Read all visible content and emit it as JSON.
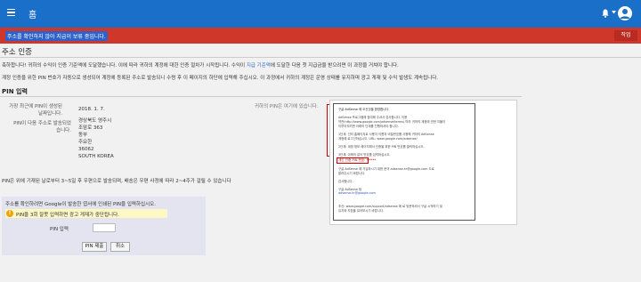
{
  "header": {
    "app_title": "홈",
    "icons": [
      "menu-icon",
      "bell-icon",
      "chevron-down-icon",
      "account-avatar"
    ],
    "brand_color": "#1a6fc9"
  },
  "alert": {
    "text": "주소를 확인하지 않아 지급이 보류 중입니다.",
    "action_label": "작업",
    "color": "#d0372b"
  },
  "page": {
    "title": "주소 인증",
    "para1_a": "축하합니다! 귀하의 수익이 인증 기준액에 도달했습니다. 이에 따라 귀하의 계정에 대한 인증 절차가 시작됩니다. 수익이 ",
    "para1_link": "지급 기준액",
    "para1_b": "에 도달한 다음 첫 지급금을 받으려면 이 과정을 거쳐야 합니다.",
    "para2": "계정 인증을 위한 PIN 번호가 자동으로 생성되어 계정에 등록된 주소로 발송되니 수령 후 이 페이지의 하단에 입력해 주십시오. 이 과정에서 귀하의 계정은 운영 상태를 유지하며 광고 게재 및 수익 발생도 계속됩니다."
  },
  "pin_section": {
    "title": "PIN 입력",
    "recent_label_1": "가장 최근에 PIN이 생성된",
    "recent_label_2": "날짜입니다.",
    "recent_value": "2018. 1. 7.",
    "addr_label_1": "PIN이 다음 주소로 발송되었",
    "addr_label_2": "습니다.",
    "address_lines": [
      "경상북도 영주시",
      "조암로 363",
      "동부",
      "주요한",
      "36062",
      "SOUTH KOREA"
    ],
    "delivery_note": "PIN은 위에 기재된 날로부터 3~5일 후 우편으로 발송되며, 배송은 우편 사정에 따라 2~4주가 걸릴 수 있습니다"
  },
  "example": {
    "caption": "귀하의 PIN은 여기에 있습니다.",
    "letter_lines": [
      "구글 AdSense 에 오신것을 환영합니다.",
      "AdSense 프로그램에 참여해 주셔서 감사합니다. 이용",
      "약관(http://www.google.com/adsense/terms) 따라 귀하의 계정에 관한 지불이",
      "이루어지려면 아래의 단계를 진행하셔야 합니다.",
      "1단계: 인터 홈페이지로 사용자 이름과 비밀번호를 사용해 귀하의 AdSense",
      "계정에 로그인하십시오. URL: www.google.com/adsense/",
      "2단계: 계정 정보 페이지에서 인증을 위한 PIN 번호를 클릭하십시오.",
      "3단계: 아래의 같이 번호를 입력하십시오.",
      "구글 AdSense 에 가입하시기 대한 문의 adsense-kr@google.com 으로",
      "알려주시기 바랍니다.",
      "감사합니다.",
      "구글 AdSense 팀",
      "adsense-kr@google.com",
      "추신: www.google.com/support/adsense 에 로 방문하셔서 구글 시작하기 및",
      "유지와 지침을 읽어보시기 바랍니다."
    ],
    "pin_line": "개인 인증 PIN 번호: ******"
  },
  "panel": {
    "instruction": "주소를 확인하려면 Google이 발송한 엽서에 인쇄된 PIN을 입력하십시오.",
    "warning": "PIN을 3회 잘못 입력하면 광고 게재가 중단됩니다.",
    "pin_label": "PIN 입력",
    "pin_input_value": "",
    "pin_input_placeholder": "",
    "submit_label": "PIN 제출",
    "cancel_label": "취소"
  }
}
